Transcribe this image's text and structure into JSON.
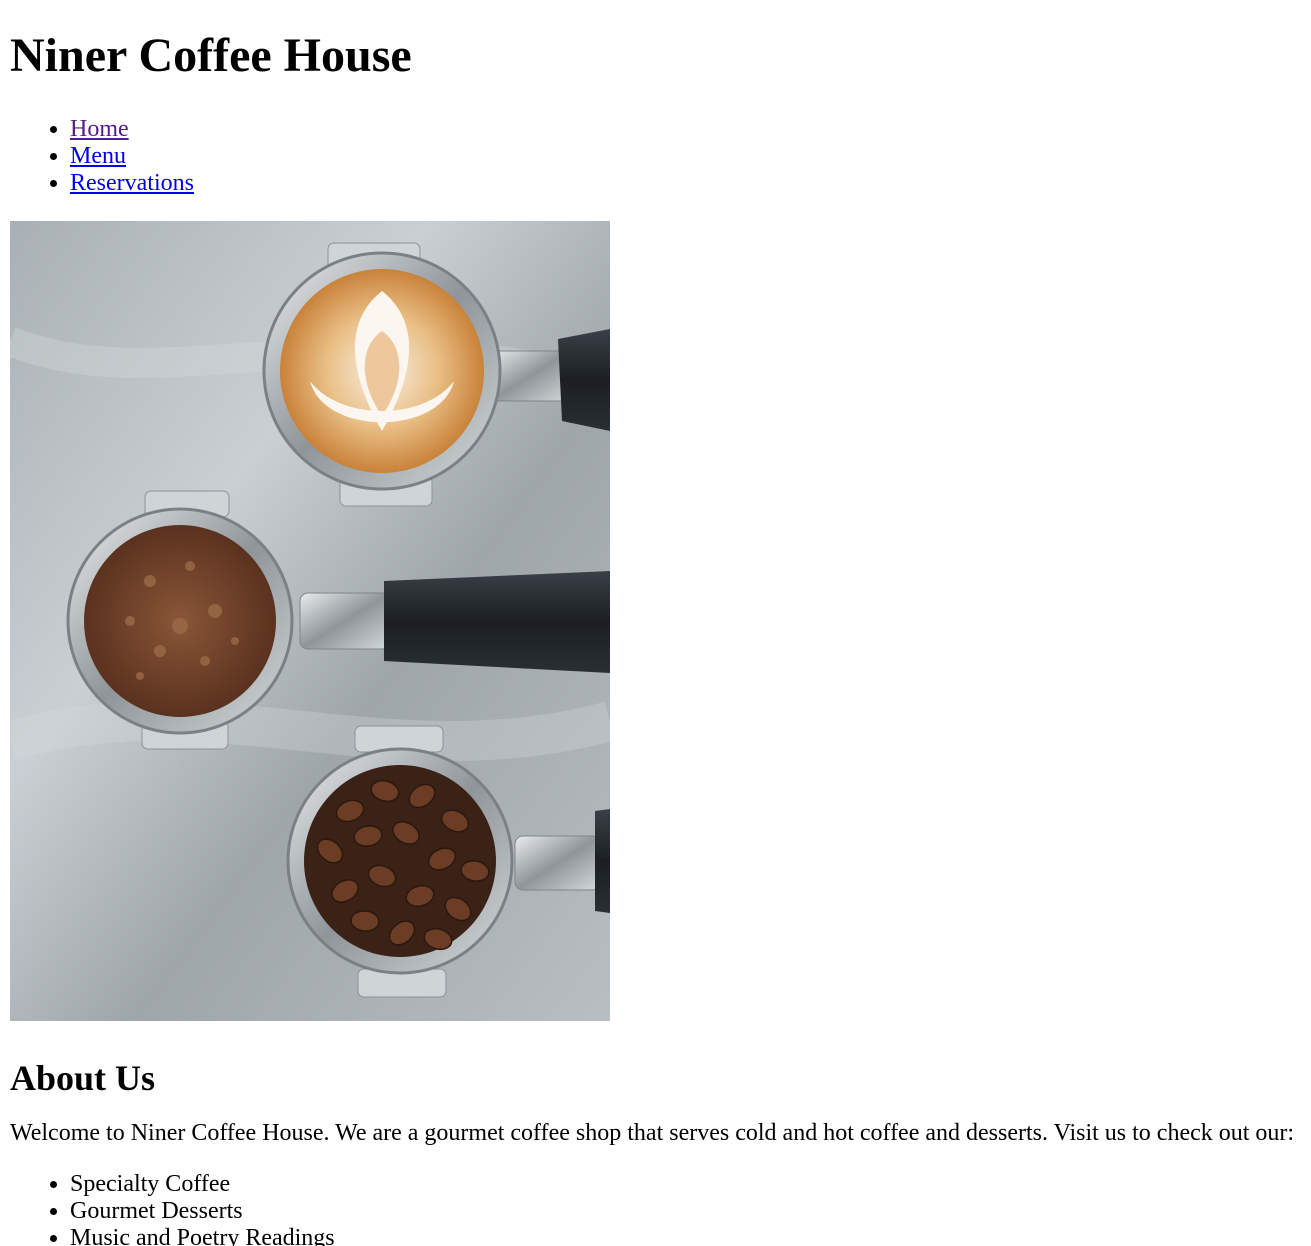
{
  "header": {
    "title": "Niner Coffee House"
  },
  "nav": {
    "items": [
      {
        "label": "Home",
        "state": "visited"
      },
      {
        "label": "Menu",
        "state": "unvisited"
      },
      {
        "label": "Reservations",
        "state": "unvisited"
      }
    ]
  },
  "hero_image": {
    "subject": "three-portafilters-latte-grounds-beans-photo"
  },
  "about": {
    "heading": "About Us",
    "text": "Welcome to Niner Coffee House. We are a gourmet coffee shop that serves cold and hot coffee and desserts. Visit us to check out our:",
    "features": [
      "Specialty Coffee",
      "Gourmet Desserts",
      "Music and Poetry Readings"
    ]
  },
  "colors": {
    "link": "#0000ee",
    "link_visited": "#551a8b",
    "text": "#000000",
    "background": "#ffffff"
  }
}
